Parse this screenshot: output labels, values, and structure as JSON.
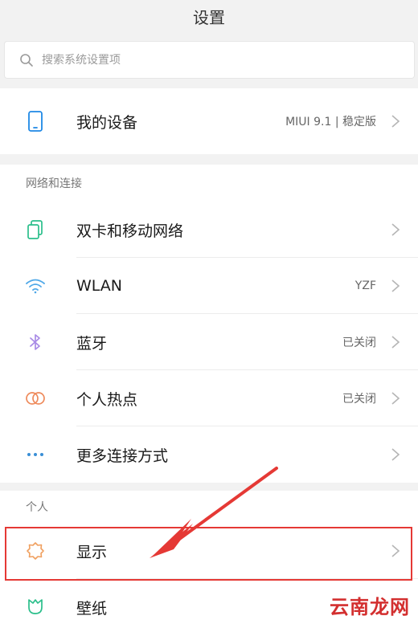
{
  "header": {
    "title": "设置"
  },
  "search": {
    "placeholder": "搜索系统设置项"
  },
  "device": {
    "label": "我的设备",
    "value": "MIUI 9.1 | 稳定版"
  },
  "network": {
    "title": "网络和连接",
    "items": [
      {
        "label": "双卡和移动网络",
        "value": ""
      },
      {
        "label": "WLAN",
        "value": "YZF"
      },
      {
        "label": "蓝牙",
        "value": "已关闭"
      },
      {
        "label": "个人热点",
        "value": "已关闭"
      },
      {
        "label": "更多连接方式",
        "value": ""
      }
    ]
  },
  "personal": {
    "title": "个人",
    "items": [
      {
        "label": "显示",
        "value": ""
      },
      {
        "label": "壁纸",
        "value": ""
      }
    ]
  },
  "watermark": "云南龙网",
  "colors": {
    "device_icon": "#1e88e5",
    "sim_icon": "#2bbf8b",
    "wifi_icon": "#4fa8e8",
    "bluetooth_icon": "#a98be6",
    "hotspot_icon": "#ee8a5b",
    "more_icon": "#3a8fd6",
    "display_icon": "#f0a060",
    "wallpaper_icon": "#2bbf8b",
    "annotation": "#e53935"
  },
  "icons": {
    "search": "search-icon",
    "device": "phone-icon",
    "sim": "dual-sim-icon",
    "wifi": "wifi-icon",
    "bluetooth": "bluetooth-icon",
    "hotspot": "hotspot-icon",
    "more": "more-dots-icon",
    "display": "sun-icon",
    "wallpaper": "tulip-icon"
  }
}
